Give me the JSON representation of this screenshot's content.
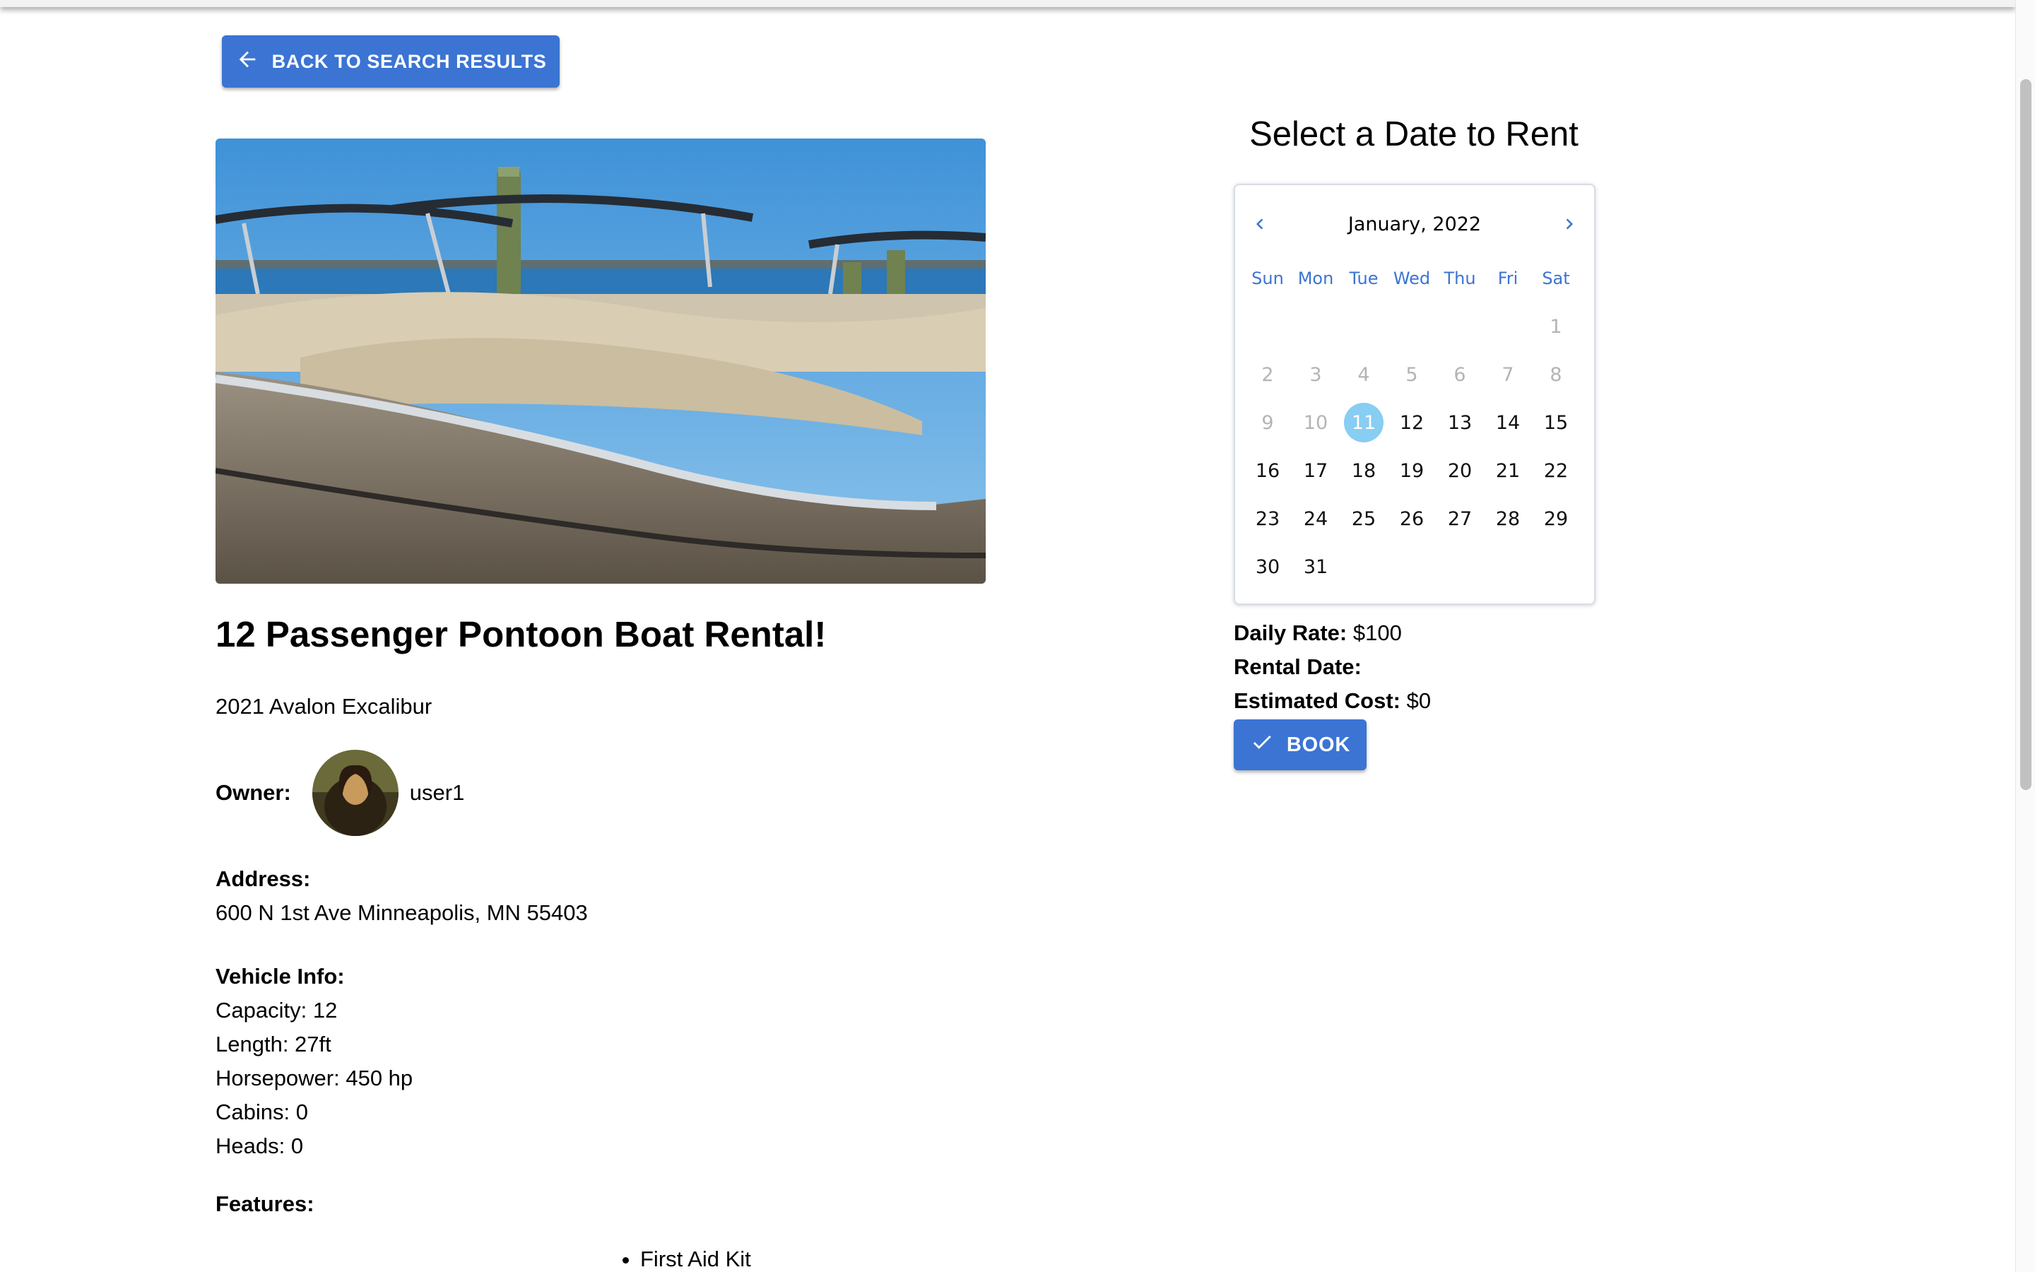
{
  "nav": {
    "back_label": "BACK TO SEARCH RESULTS"
  },
  "listing": {
    "title": "12 Passenger Pontoon Boat Rental!",
    "model": "2021 Avalon Excalibur",
    "owner_label": "Owner:",
    "owner_name": "user1",
    "address_label": "Address:",
    "address": "600 N 1st Ave Minneapolis, MN 55403",
    "vehicle_info_label": "Vehicle Info:",
    "vehicle_info": [
      "Capacity: 12",
      "Length: 27ft",
      "Horsepower: 450 hp",
      "Cabins: 0",
      "Heads: 0"
    ],
    "features_label": "Features:",
    "features": [
      "First Aid Kit"
    ]
  },
  "calendar": {
    "heading": "Select a Date to Rent",
    "month_label": "January, 2022",
    "weekdays": [
      "Sun",
      "Mon",
      "Tue",
      "Wed",
      "Thu",
      "Fri",
      "Sat"
    ],
    "first_weekday_index": 6,
    "days_in_month": 31,
    "disabled_days": [
      1,
      2,
      3,
      4,
      5,
      6,
      7,
      8,
      9,
      10
    ],
    "selected_day": 11,
    "accent_color": "#3b74d3",
    "selected_color": "#88cdf2"
  },
  "summary": {
    "daily_rate_label": "Daily Rate:",
    "daily_rate": "$100",
    "rental_date_label": "Rental Date:",
    "rental_date": "",
    "estimated_cost_label": "Estimated Cost:",
    "estimated_cost": "$0"
  },
  "actions": {
    "book_label": "BOOK"
  }
}
